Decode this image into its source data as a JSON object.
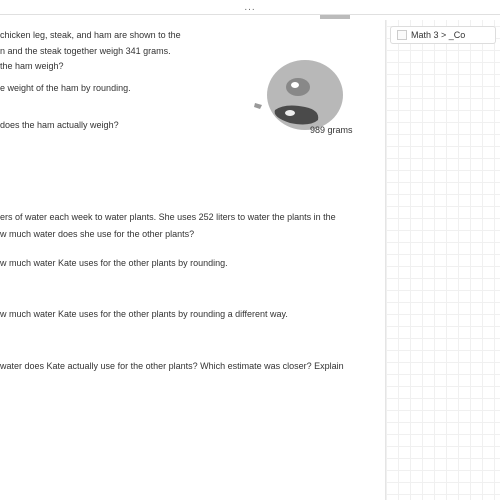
{
  "toolbar": {
    "dots": "...",
    "tab_label": "Math 3 > _Co"
  },
  "problem1": {
    "intro_l1": "chicken leg, steak, and ham are shown to the",
    "intro_l2": "n and the steak together weigh 341 grams.",
    "intro_l3": "the ham weigh?",
    "part_a": "e weight of the ham by rounding.",
    "part_b": "does the ham actually weigh?",
    "weight_label": "989 grams"
  },
  "problem2": {
    "intro_l1": "ers of water each week to water plants.  She uses 252 liters to water the plants in the",
    "intro_l2": "w much water does she use for the other plants?",
    "part_a": "w much water Kate uses for the other plants by rounding.",
    "part_b": "w much water Kate uses for the other plants by rounding a different way.",
    "part_c": "water does Kate actually use for the other plants?  Which estimate was closer?  Explain"
  }
}
